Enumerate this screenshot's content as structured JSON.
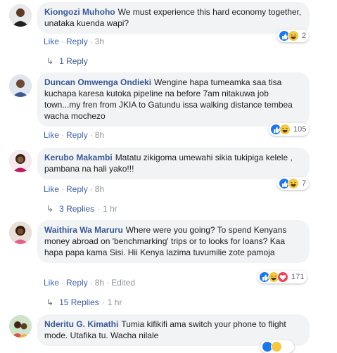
{
  "comments": [
    {
      "author": "Kiongozi Muhoho",
      "text": "We must experience this hard economy together, unataka kuenda wapi?",
      "actions": {
        "like": "Like",
        "reply": "Reply",
        "time": "3h",
        "edited": ""
      },
      "reaction_count": "2",
      "replies_label": "1 Reply",
      "replies_time": ""
    },
    {
      "author": "Duncan Omwenga Ondieki",
      "text": "Wengine hapa tumeamka saa tisa kuchapa karesa kutoka pipeline na before 7am nitakuwa job town...my fren from JKIA to Gatundu issa walking distance tembea wacha mochezo",
      "actions": {
        "like": "Like",
        "reply": "Reply",
        "time": "8h",
        "edited": ""
      },
      "reaction_count": "105"
    },
    {
      "author": "Kerubo Makambi",
      "text": "Matatu zikigoma umewahi sikia tukipiga kelele , pambana na hali yako!!!",
      "actions": {
        "like": "Like",
        "reply": "Reply",
        "time": "8h",
        "edited": ""
      },
      "reaction_count": "7",
      "replies_label": "3 Replies",
      "replies_time": "1 hr"
    },
    {
      "author": "Waithira Wa Maruru",
      "text": "Where were you going? To spend Kenyans money abroad on 'benchmarking' trips or to looks for loans? Kaa hapa papa kama Sisi. Hii Kenya lazima tuvumilie zote pamoja",
      "actions": {
        "like": "Like",
        "reply": "Reply",
        "time": "8h",
        "edited": "Edited"
      },
      "reaction_count": "171",
      "replies_label": "15 Replies",
      "replies_time": "1 hr"
    },
    {
      "author": "Nderitu G. Kimathi",
      "text": "Tumia kifikifi ama switch your phone to flight mode. Utafika tu. Wacha nilale"
    }
  ],
  "colors": {
    "author": "#385898",
    "link": "#4267b2",
    "bubble": "#f2f3f5",
    "meta": "#90949c"
  },
  "icons": {
    "like": "thumbs-up-icon",
    "haha": "laughing-face-icon",
    "love": "heart-icon",
    "reply_arrow": "reply-arrow-icon"
  }
}
